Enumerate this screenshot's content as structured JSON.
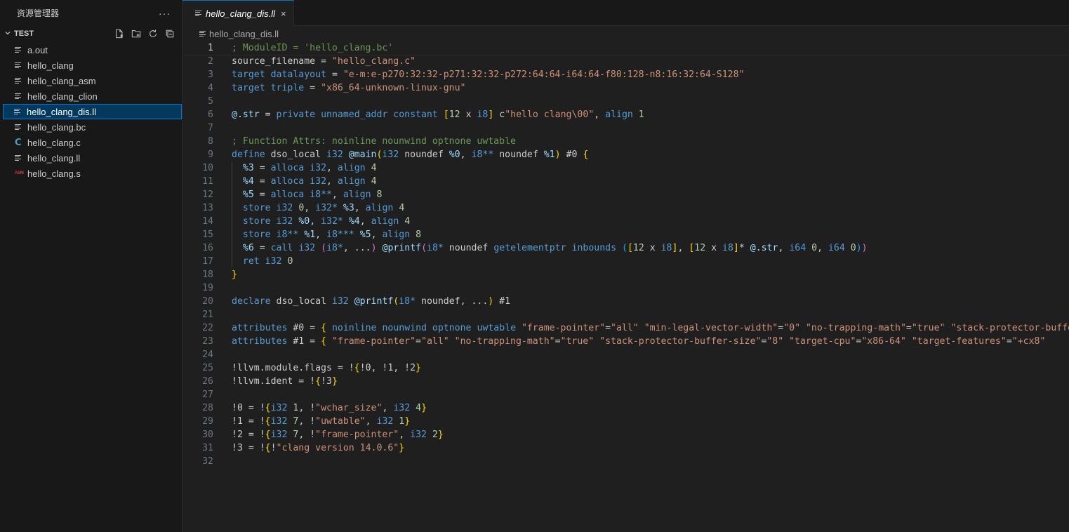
{
  "colors": {
    "background": "#1f1f1f",
    "sidebar_background": "#181818",
    "selection": "#04395e",
    "focus_border": "#0078d4"
  },
  "sidebar": {
    "title": "资源管理器",
    "more_label": "···",
    "section_title": "TEST",
    "actions": [
      {
        "icon": "new-file-icon"
      },
      {
        "icon": "new-folder-icon"
      },
      {
        "icon": "refresh-icon"
      },
      {
        "icon": "collapse-all-icon"
      }
    ],
    "files": [
      {
        "name": "a.out",
        "icon": "file-lines-icon",
        "selected": false
      },
      {
        "name": "hello_clang",
        "icon": "file-lines-icon",
        "selected": false
      },
      {
        "name": "hello_clang_asm",
        "icon": "file-lines-icon",
        "selected": false
      },
      {
        "name": "hello_clang_clion",
        "icon": "file-lines-icon",
        "selected": false
      },
      {
        "name": "hello_clang_dis.ll",
        "icon": "file-lines-icon",
        "selected": true
      },
      {
        "name": "hello_clang.bc",
        "icon": "file-lines-icon",
        "selected": false
      },
      {
        "name": "hello_clang.c",
        "icon": "c-file-icon",
        "selected": false
      },
      {
        "name": "hello_clang.ll",
        "icon": "file-lines-icon",
        "selected": false
      },
      {
        "name": "hello_clang.s",
        "icon": "asm-file-icon",
        "selected": false
      }
    ]
  },
  "editor": {
    "tab_label": "hello_clang_dis.ll",
    "tab_close": "×",
    "breadcrumb": "hello_clang_dis.ll",
    "current_line": 1,
    "lines": [
      [
        [
          "; ModuleID = 'hello_clang.bc'",
          "comment"
        ]
      ],
      [
        [
          "source_filename = ",
          "plain"
        ],
        [
          "\"hello_clang.c\"",
          "string"
        ]
      ],
      [
        [
          "target",
          "keyword"
        ],
        [
          " ",
          "plain"
        ],
        [
          "datalayout",
          "keyword"
        ],
        [
          " = ",
          "plain"
        ],
        [
          "\"e-m:e-p270:32:32-p271:32:32-p272:64:64-i64:64-f80:128-n8:16:32:64-S128\"",
          "string"
        ]
      ],
      [
        [
          "target",
          "keyword"
        ],
        [
          " ",
          "plain"
        ],
        [
          "triple",
          "keyword"
        ],
        [
          " = ",
          "plain"
        ],
        [
          "\"x86_64-unknown-linux-gnu\"",
          "string"
        ]
      ],
      [],
      [
        [
          "@.str",
          "var"
        ],
        [
          " = ",
          "plain"
        ],
        [
          "private",
          "keyword"
        ],
        [
          " ",
          "plain"
        ],
        [
          "unnamed_addr",
          "keyword"
        ],
        [
          " ",
          "plain"
        ],
        [
          "constant",
          "keyword"
        ],
        [
          " ",
          "plain"
        ],
        [
          "[",
          "p1"
        ],
        [
          "12",
          "number"
        ],
        [
          " x ",
          "plain"
        ],
        [
          "i8",
          "type"
        ],
        [
          "]",
          "p1"
        ],
        [
          " c",
          "plain"
        ],
        [
          "\"hello clang\\00\"",
          "string"
        ],
        [
          ", ",
          "plain"
        ],
        [
          "align",
          "keyword"
        ],
        [
          " ",
          "plain"
        ],
        [
          "1",
          "number"
        ]
      ],
      [],
      [
        [
          "; Function Attrs: noinline nounwind optnone uwtable",
          "comment"
        ]
      ],
      [
        [
          "define",
          "keyword"
        ],
        [
          " dso_local ",
          "plain"
        ],
        [
          "i32",
          "type"
        ],
        [
          " ",
          "plain"
        ],
        [
          "@main",
          "var"
        ],
        [
          "(",
          "p1"
        ],
        [
          "i32",
          "type"
        ],
        [
          " noundef ",
          "plain"
        ],
        [
          "%0",
          "var"
        ],
        [
          ", ",
          "plain"
        ],
        [
          "i8**",
          "type"
        ],
        [
          " noundef ",
          "plain"
        ],
        [
          "%1",
          "var"
        ],
        [
          ")",
          "p1"
        ],
        [
          " #0 ",
          "plain"
        ],
        [
          "{",
          "p1"
        ]
      ],
      [
        [
          "  ",
          "plain"
        ],
        [
          "%3",
          "var"
        ],
        [
          " = ",
          "plain"
        ],
        [
          "alloca",
          "keyword"
        ],
        [
          " ",
          "plain"
        ],
        [
          "i32",
          "type"
        ],
        [
          ", ",
          "plain"
        ],
        [
          "align",
          "keyword"
        ],
        [
          " ",
          "plain"
        ],
        [
          "4",
          "number"
        ]
      ],
      [
        [
          "  ",
          "plain"
        ],
        [
          "%4",
          "var"
        ],
        [
          " = ",
          "plain"
        ],
        [
          "alloca",
          "keyword"
        ],
        [
          " ",
          "plain"
        ],
        [
          "i32",
          "type"
        ],
        [
          ", ",
          "plain"
        ],
        [
          "align",
          "keyword"
        ],
        [
          " ",
          "plain"
        ],
        [
          "4",
          "number"
        ]
      ],
      [
        [
          "  ",
          "plain"
        ],
        [
          "%5",
          "var"
        ],
        [
          " = ",
          "plain"
        ],
        [
          "alloca",
          "keyword"
        ],
        [
          " ",
          "plain"
        ],
        [
          "i8**",
          "type"
        ],
        [
          ", ",
          "plain"
        ],
        [
          "align",
          "keyword"
        ],
        [
          " ",
          "plain"
        ],
        [
          "8",
          "number"
        ]
      ],
      [
        [
          "  ",
          "plain"
        ],
        [
          "store",
          "keyword"
        ],
        [
          " ",
          "plain"
        ],
        [
          "i32",
          "type"
        ],
        [
          " ",
          "plain"
        ],
        [
          "0",
          "number"
        ],
        [
          ", ",
          "plain"
        ],
        [
          "i32*",
          "type"
        ],
        [
          " ",
          "plain"
        ],
        [
          "%3",
          "var"
        ],
        [
          ", ",
          "plain"
        ],
        [
          "align",
          "keyword"
        ],
        [
          " ",
          "plain"
        ],
        [
          "4",
          "number"
        ]
      ],
      [
        [
          "  ",
          "plain"
        ],
        [
          "store",
          "keyword"
        ],
        [
          " ",
          "plain"
        ],
        [
          "i32",
          "type"
        ],
        [
          " ",
          "plain"
        ],
        [
          "%0",
          "var"
        ],
        [
          ", ",
          "plain"
        ],
        [
          "i32*",
          "type"
        ],
        [
          " ",
          "plain"
        ],
        [
          "%4",
          "var"
        ],
        [
          ", ",
          "plain"
        ],
        [
          "align",
          "keyword"
        ],
        [
          " ",
          "plain"
        ],
        [
          "4",
          "number"
        ]
      ],
      [
        [
          "  ",
          "plain"
        ],
        [
          "store",
          "keyword"
        ],
        [
          " ",
          "plain"
        ],
        [
          "i8**",
          "type"
        ],
        [
          " ",
          "plain"
        ],
        [
          "%1",
          "var"
        ],
        [
          ", ",
          "plain"
        ],
        [
          "i8***",
          "type"
        ],
        [
          " ",
          "plain"
        ],
        [
          "%5",
          "var"
        ],
        [
          ", ",
          "plain"
        ],
        [
          "align",
          "keyword"
        ],
        [
          " ",
          "plain"
        ],
        [
          "8",
          "number"
        ]
      ],
      [
        [
          "  ",
          "plain"
        ],
        [
          "%6",
          "var"
        ],
        [
          " = ",
          "plain"
        ],
        [
          "call",
          "keyword"
        ],
        [
          " ",
          "plain"
        ],
        [
          "i32",
          "type"
        ],
        [
          " ",
          "plain"
        ],
        [
          "(",
          "p2"
        ],
        [
          "i8*",
          "type"
        ],
        [
          ", ...",
          "plain"
        ],
        [
          ")",
          "p2"
        ],
        [
          " ",
          "plain"
        ],
        [
          "@printf",
          "var"
        ],
        [
          "(",
          "p2"
        ],
        [
          "i8*",
          "type"
        ],
        [
          " noundef ",
          "plain"
        ],
        [
          "getelementptr",
          "keyword"
        ],
        [
          " ",
          "plain"
        ],
        [
          "inbounds",
          "keyword"
        ],
        [
          " ",
          "plain"
        ],
        [
          "(",
          "p3"
        ],
        [
          "[",
          "p1"
        ],
        [
          "12",
          "number"
        ],
        [
          " x ",
          "plain"
        ],
        [
          "i8",
          "type"
        ],
        [
          "]",
          "p1"
        ],
        [
          ", ",
          "plain"
        ],
        [
          "[",
          "p1"
        ],
        [
          "12",
          "number"
        ],
        [
          " x ",
          "plain"
        ],
        [
          "i8",
          "type"
        ],
        [
          "]",
          "p1"
        ],
        [
          "* ",
          "plain"
        ],
        [
          "@.str",
          "var"
        ],
        [
          ", ",
          "plain"
        ],
        [
          "i64",
          "type"
        ],
        [
          " ",
          "plain"
        ],
        [
          "0",
          "number"
        ],
        [
          ", ",
          "plain"
        ],
        [
          "i64",
          "type"
        ],
        [
          " ",
          "plain"
        ],
        [
          "0",
          "number"
        ],
        [
          ")",
          "p3"
        ],
        [
          ")",
          "p2"
        ]
      ],
      [
        [
          "  ",
          "plain"
        ],
        [
          "ret",
          "keyword"
        ],
        [
          " ",
          "plain"
        ],
        [
          "i32",
          "type"
        ],
        [
          " ",
          "plain"
        ],
        [
          "0",
          "number"
        ]
      ],
      [
        [
          "}",
          "p1"
        ]
      ],
      [],
      [
        [
          "declare",
          "keyword"
        ],
        [
          " dso_local ",
          "plain"
        ],
        [
          "i32",
          "type"
        ],
        [
          " ",
          "plain"
        ],
        [
          "@printf",
          "var"
        ],
        [
          "(",
          "p1"
        ],
        [
          "i8*",
          "type"
        ],
        [
          " noundef, ...",
          "plain"
        ],
        [
          ")",
          "p1"
        ],
        [
          " #1",
          "plain"
        ]
      ],
      [],
      [
        [
          "attributes",
          "keyword"
        ],
        [
          " #0 = ",
          "plain"
        ],
        [
          "{",
          "p1"
        ],
        [
          " ",
          "plain"
        ],
        [
          "noinline",
          "keyword"
        ],
        [
          " ",
          "plain"
        ],
        [
          "nounwind",
          "keyword"
        ],
        [
          " ",
          "plain"
        ],
        [
          "optnone",
          "keyword"
        ],
        [
          " ",
          "plain"
        ],
        [
          "uwtable",
          "keyword"
        ],
        [
          " ",
          "plain"
        ],
        [
          "\"frame-pointer\"",
          "string"
        ],
        [
          "=",
          "plain"
        ],
        [
          "\"all\"",
          "string"
        ],
        [
          " ",
          "plain"
        ],
        [
          "\"min-legal-vector-width\"",
          "string"
        ],
        [
          "=",
          "plain"
        ],
        [
          "\"0\"",
          "string"
        ],
        [
          " ",
          "plain"
        ],
        [
          "\"no-trapping-math\"",
          "string"
        ],
        [
          "=",
          "plain"
        ],
        [
          "\"true\"",
          "string"
        ],
        [
          " ",
          "plain"
        ],
        [
          "\"stack-protector-buffer-size\"",
          "string"
        ]
      ],
      [
        [
          "attributes",
          "keyword"
        ],
        [
          " #1 = ",
          "plain"
        ],
        [
          "{",
          "p1"
        ],
        [
          " ",
          "plain"
        ],
        [
          "\"frame-pointer\"",
          "string"
        ],
        [
          "=",
          "plain"
        ],
        [
          "\"all\"",
          "string"
        ],
        [
          " ",
          "plain"
        ],
        [
          "\"no-trapping-math\"",
          "string"
        ],
        [
          "=",
          "plain"
        ],
        [
          "\"true\"",
          "string"
        ],
        [
          " ",
          "plain"
        ],
        [
          "\"stack-protector-buffer-size\"",
          "string"
        ],
        [
          "=",
          "plain"
        ],
        [
          "\"8\"",
          "string"
        ],
        [
          " ",
          "plain"
        ],
        [
          "\"target-cpu\"",
          "string"
        ],
        [
          "=",
          "plain"
        ],
        [
          "\"x86-64\"",
          "string"
        ],
        [
          " ",
          "plain"
        ],
        [
          "\"target-features\"",
          "string"
        ],
        [
          "=",
          "plain"
        ],
        [
          "\"+cx8\"",
          "string"
        ]
      ],
      [],
      [
        [
          "!llvm.module.flags = !",
          "plain"
        ],
        [
          "{",
          "p1"
        ],
        [
          "!0, !1, !2",
          "plain"
        ],
        [
          "}",
          "p1"
        ]
      ],
      [
        [
          "!llvm.ident = !",
          "plain"
        ],
        [
          "{",
          "p1"
        ],
        [
          "!3",
          "plain"
        ],
        [
          "}",
          "p1"
        ]
      ],
      [],
      [
        [
          "!0 = !",
          "plain"
        ],
        [
          "{",
          "p1"
        ],
        [
          "i32",
          "type"
        ],
        [
          " ",
          "plain"
        ],
        [
          "1",
          "number"
        ],
        [
          ", !",
          "plain"
        ],
        [
          "\"wchar_size\"",
          "string"
        ],
        [
          ", ",
          "plain"
        ],
        [
          "i32",
          "type"
        ],
        [
          " ",
          "plain"
        ],
        [
          "4",
          "number"
        ],
        [
          "}",
          "p1"
        ]
      ],
      [
        [
          "!1 = !",
          "plain"
        ],
        [
          "{",
          "p1"
        ],
        [
          "i32",
          "type"
        ],
        [
          " ",
          "plain"
        ],
        [
          "7",
          "number"
        ],
        [
          ", !",
          "plain"
        ],
        [
          "\"uwtable\"",
          "string"
        ],
        [
          ", ",
          "plain"
        ],
        [
          "i32",
          "type"
        ],
        [
          " ",
          "plain"
        ],
        [
          "1",
          "number"
        ],
        [
          "}",
          "p1"
        ]
      ],
      [
        [
          "!2 = !",
          "plain"
        ],
        [
          "{",
          "p1"
        ],
        [
          "i32",
          "type"
        ],
        [
          " ",
          "plain"
        ],
        [
          "7",
          "number"
        ],
        [
          ", !",
          "plain"
        ],
        [
          "\"frame-pointer\"",
          "string"
        ],
        [
          ", ",
          "plain"
        ],
        [
          "i32",
          "type"
        ],
        [
          " ",
          "plain"
        ],
        [
          "2",
          "number"
        ],
        [
          "}",
          "p1"
        ]
      ],
      [
        [
          "!3 = !",
          "plain"
        ],
        [
          "{",
          "p1"
        ],
        [
          "!",
          "plain"
        ],
        [
          "\"clang version 14.0.6\"",
          "string"
        ],
        [
          "}",
          "p1"
        ]
      ],
      []
    ]
  }
}
